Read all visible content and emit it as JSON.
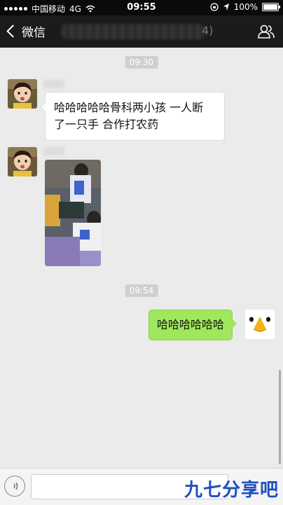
{
  "status_bar": {
    "carrier": "中国移动",
    "network": "4G",
    "time": "09:55",
    "battery": "100%"
  },
  "nav": {
    "back_label": "微信",
    "title_suffix": "4)"
  },
  "messages": [
    {
      "type": "timestamp",
      "text": "09:30"
    },
    {
      "type": "text",
      "side": "left",
      "lines": [
        "哈哈哈哈哈骨科两小孩 一人断",
        "了一只手 合作打农药"
      ]
    },
    {
      "type": "image",
      "side": "left"
    },
    {
      "type": "timestamp",
      "text": "09:54"
    },
    {
      "type": "text",
      "side": "right",
      "text": "哈哈哈哈哈哈"
    }
  ],
  "input_bar": {
    "watermark": "九七分享吧"
  },
  "colors": {
    "nav_bg": "#1b1b1b",
    "chat_bg": "#ebebeb",
    "bubble_self": "#9fe75d",
    "watermark": "#1f4fbf"
  },
  "icons": [
    "wifi-icon",
    "location-icon",
    "battery-icon",
    "back-chevron-icon",
    "contacts-icon",
    "voice-icon"
  ]
}
